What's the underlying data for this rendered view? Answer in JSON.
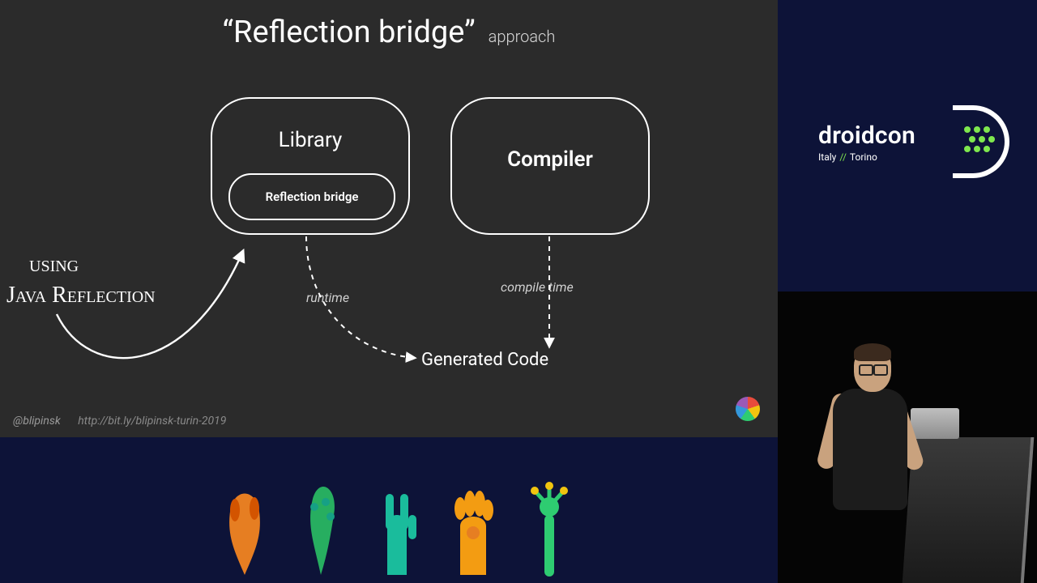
{
  "slide": {
    "title_main": "“Reflection bridge”",
    "title_sub": "approach",
    "box_library": "Library",
    "box_inner": "Reflection bridge",
    "box_compiler": "Compiler",
    "generated": "Generated Code",
    "runtime_label": "runtime",
    "compiletime_label": "compile time",
    "hand_note_line1": "using",
    "hand_note_line2": "Java Reflection",
    "footer_handle": "@blipinsk",
    "footer_link": "http://bit.ly/blipinsk-turin-2019"
  },
  "logo": {
    "brand": "droidcon",
    "sub_left": "Italy",
    "sub_sep": "//",
    "sub_right": "Torino"
  },
  "colors": {
    "slide_bg": "#2b2b2b",
    "panel_bg": "#0d1338",
    "accent_green": "#7fe84e"
  }
}
